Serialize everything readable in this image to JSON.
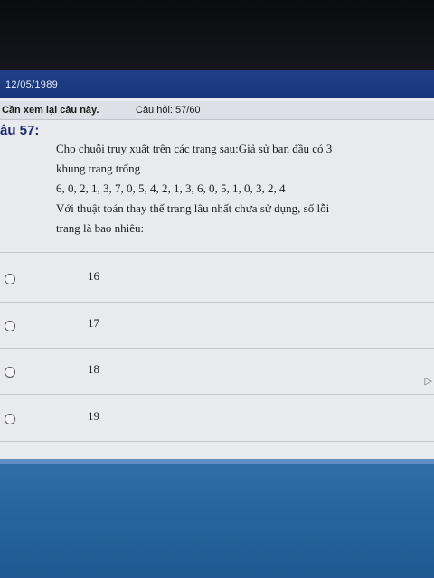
{
  "title_bar": {
    "date": "12/05/1989"
  },
  "status": {
    "review_label": "Cần xem lại câu này.",
    "question_counter": "Câu hỏi: 57/60"
  },
  "question": {
    "label": "âu 57:",
    "lines": [
      "Cho chuỗi truy xuất trên các trang sau:Giả sử ban đầu có 3",
      "khung trang trống",
      "6, 0, 2, 1, 3, 7, 0, 5, 4, 2, 1, 3, 6, 0, 5, 1, 0, 3, 2, 4",
      "Với thuật toán thay thế trang lâu nhất chưa sử dụng, số lỗi",
      "trang là bao nhiêu:"
    ]
  },
  "options": [
    "16",
    "17",
    "18",
    "19"
  ],
  "colors": {
    "title_bar": "#17357a",
    "page_bg": "#e9eaed",
    "lower_bg": "#1f5892"
  }
}
